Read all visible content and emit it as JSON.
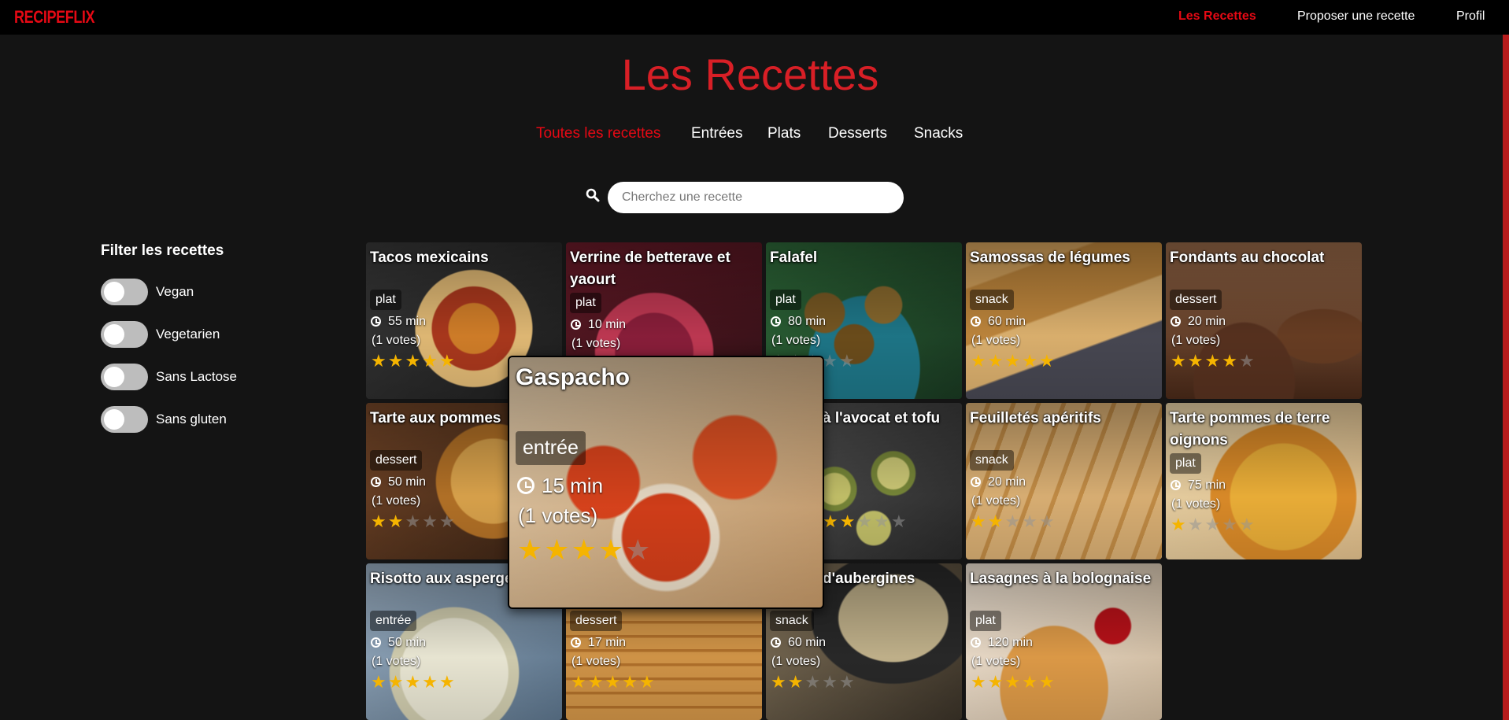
{
  "brand": {
    "logo": "RECIPEFLIX",
    "accent": "#e50914"
  },
  "nav": {
    "recipes": "Les Recettes",
    "propose": "Proposer une recette",
    "profile": "Profil"
  },
  "page_title": "Les Recettes",
  "categories": [
    "Toutes les recettes",
    "Entrées",
    "Plats",
    "Desserts",
    "Snacks"
  ],
  "search": {
    "placeholder": "Cherchez une recette",
    "icon": "search-icon"
  },
  "filters": {
    "title": "Filter les recettes",
    "items": [
      {
        "label": "Vegan",
        "checked": false
      },
      {
        "label": "Vegetarien",
        "checked": false
      },
      {
        "label": "Sans Lactose",
        "checked": false
      },
      {
        "label": "Sans gluten",
        "checked": false
      }
    ]
  },
  "recipes": [
    {
      "title": "Tacos mexicains",
      "category": "plat",
      "time": "55 min",
      "votes": "(1 votes)",
      "rating": 5
    },
    {
      "title": "Verrine de betterave et yaourt",
      "category": "plat",
      "time": "10 min",
      "votes": "(1 votes)",
      "rating": 0
    },
    {
      "title": "Falafel",
      "category": "plat",
      "time": "80 min",
      "votes": "(1 votes)",
      "rating": 0
    },
    {
      "title": "Samossas de légumes",
      "category": "snack",
      "time": "60 min",
      "votes": "(1 votes)",
      "rating": 5
    },
    {
      "title": "Fondants au chocolat",
      "category": "dessert",
      "time": "20 min",
      "votes": "(1 votes)",
      "rating": 4
    },
    {
      "title": "Tarte aux pommes",
      "category": "dessert",
      "time": "50 min",
      "votes": "(1 votes)",
      "rating": 2
    },
    {
      "title": "à l'avocat et tofu",
      "category": "",
      "time": "",
      "votes": "",
      "rating": 2
    },
    {
      "title": "Feuilletés apéritifs",
      "category": "snack",
      "time": "20 min",
      "votes": "(1 votes)",
      "rating": 2
    },
    {
      "title": "Tarte pommes de terre oignons",
      "category": "plat",
      "time": "75 min",
      "votes": "(1 votes)",
      "rating": 1
    },
    {
      "title": "Risotto aux asperges",
      "category": "entrée",
      "time": "50 min",
      "votes": "(1 votes)",
      "rating": 5
    },
    {
      "title": "",
      "category": "dessert",
      "time": "17 min",
      "votes": "(1 votes)",
      "rating": 5
    },
    {
      "title": "d'aubergines",
      "category": "snack",
      "time": "60 min",
      "votes": "(1 votes)",
      "rating": 2
    },
    {
      "title": "Lasagnes à la bolognaise",
      "category": "plat",
      "time": "120 min",
      "votes": "(1 votes)",
      "rating": 5
    }
  ],
  "featured": {
    "title": "Gaspacho",
    "category": "entrée",
    "time": "15 min",
    "votes": "(1 votes)",
    "rating": 4
  }
}
